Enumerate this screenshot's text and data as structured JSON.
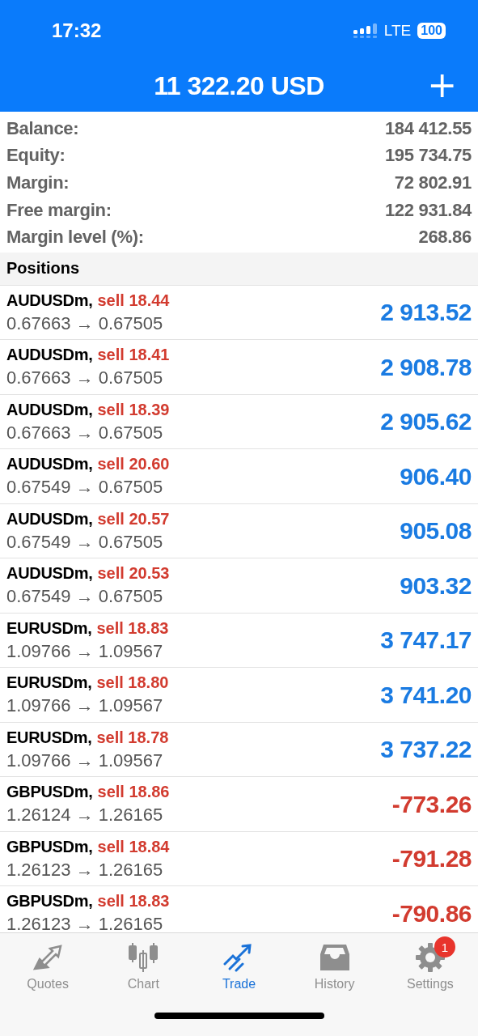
{
  "status_bar": {
    "time": "17:32",
    "network": "LTE",
    "battery": "100"
  },
  "header": {
    "title": "11 322.20 USD",
    "action": "+"
  },
  "summary": [
    {
      "label": "Balance:",
      "value": "184 412.55"
    },
    {
      "label": "Equity:",
      "value": "195 734.75"
    },
    {
      "label": "Margin:",
      "value": "72 802.91"
    },
    {
      "label": "Free margin:",
      "value": "122 931.84"
    },
    {
      "label": "Margin level (%):",
      "value": "268.86"
    }
  ],
  "positions_title": "Positions",
  "positions": [
    {
      "symbol": "AUDUSDm,",
      "order": "sell 18.44",
      "prices": "0.67663 → 0.67505",
      "profit": "2 913.52",
      "kind": "gain"
    },
    {
      "symbol": "AUDUSDm,",
      "order": "sell 18.41",
      "prices": "0.67663 → 0.67505",
      "profit": "2 908.78",
      "kind": "gain"
    },
    {
      "symbol": "AUDUSDm,",
      "order": "sell 18.39",
      "prices": "0.67663 → 0.67505",
      "profit": "2 905.62",
      "kind": "gain"
    },
    {
      "symbol": "AUDUSDm,",
      "order": "sell 20.60",
      "prices": "0.67549 → 0.67505",
      "profit": "906.40",
      "kind": "gain"
    },
    {
      "symbol": "AUDUSDm,",
      "order": "sell 20.57",
      "prices": "0.67549 → 0.67505",
      "profit": "905.08",
      "kind": "gain"
    },
    {
      "symbol": "AUDUSDm,",
      "order": "sell 20.53",
      "prices": "0.67549 → 0.67505",
      "profit": "903.32",
      "kind": "gain"
    },
    {
      "symbol": "EURUSDm,",
      "order": "sell 18.83",
      "prices": "1.09766 → 1.09567",
      "profit": "3 747.17",
      "kind": "gain"
    },
    {
      "symbol": "EURUSDm,",
      "order": "sell 18.80",
      "prices": "1.09766 → 1.09567",
      "profit": "3 741.20",
      "kind": "gain"
    },
    {
      "symbol": "EURUSDm,",
      "order": "sell 18.78",
      "prices": "1.09766 → 1.09567",
      "profit": "3 737.22",
      "kind": "gain"
    },
    {
      "symbol": "GBPUSDm,",
      "order": "sell 18.86",
      "prices": "1.26124 → 1.26165",
      "profit": "-773.26",
      "kind": "loss"
    },
    {
      "symbol": "GBPUSDm,",
      "order": "sell 18.84",
      "prices": "1.26123 → 1.26165",
      "profit": "-791.28",
      "kind": "loss"
    },
    {
      "symbol": "GBPUSDm,",
      "order": "sell 18.83",
      "prices": "1.26123 → 1.26165",
      "profit": "-790.86",
      "kind": "loss"
    }
  ],
  "tabs": [
    {
      "label": "Quotes",
      "kind": "quotes",
      "selected": false
    },
    {
      "label": "Chart",
      "kind": "chart",
      "selected": false
    },
    {
      "label": "Trade",
      "kind": "trade",
      "selected": true
    },
    {
      "label": "History",
      "kind": "history",
      "selected": false
    },
    {
      "label": "Settings",
      "kind": "settings",
      "selected": false,
      "badge": "1"
    }
  ]
}
